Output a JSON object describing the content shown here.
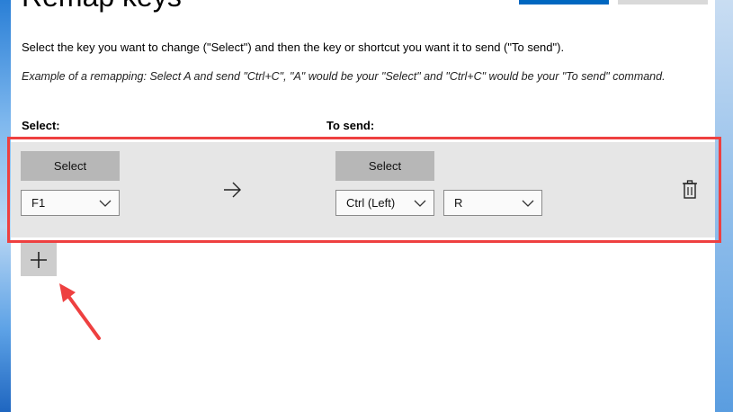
{
  "window": {
    "title": "Remap keys"
  },
  "instructions": {
    "main": "Select the key you want to change (\"Select\") and then the key or shortcut you want it to send (\"To send\").",
    "example": "Example of a remapping: Select A and send \"Ctrl+C\", \"A\" would be your \"Select\" and \"Ctrl+C\" would be your \"To send\" command."
  },
  "columns": {
    "select_label": "Select:",
    "to_send_label": "To send:"
  },
  "mapping_row": {
    "select_button_label": "Select",
    "select_key_value": "F1",
    "to_send_button_label": "Select",
    "to_send_modifier_value": "Ctrl (Left)",
    "to_send_key_value": "R"
  },
  "icons": {
    "arrow": "arrow-right-icon",
    "delete": "trash-icon",
    "add": "plus-icon",
    "chevron": "chevron-down-icon"
  },
  "colors": {
    "accent": "#0067c0",
    "highlight": "#ee4040",
    "row_background": "#e6e6e6",
    "button_gray": "#b7b7b7"
  }
}
